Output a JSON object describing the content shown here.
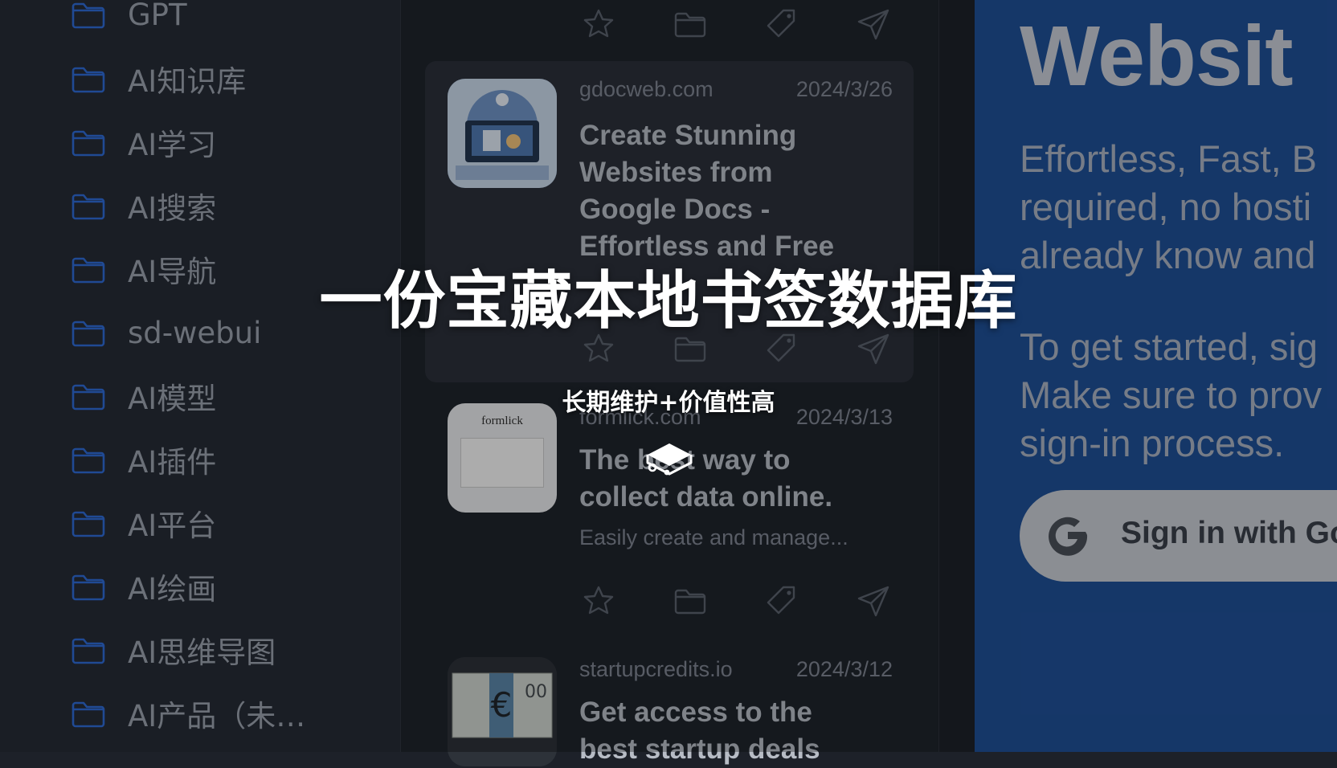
{
  "sidebar": {
    "folders": [
      {
        "label": "GPT"
      },
      {
        "label": "AI知识库"
      },
      {
        "label": "AI学习"
      },
      {
        "label": "AI搜索"
      },
      {
        "label": "AI导航"
      },
      {
        "label": "sd-webui"
      },
      {
        "label": "AI模型"
      },
      {
        "label": "AI插件"
      },
      {
        "label": "AI平台"
      },
      {
        "label": "AI绘画"
      },
      {
        "label": "AI思维导图"
      },
      {
        "label": "AI产品（未…"
      }
    ]
  },
  "bookmarks": [
    {
      "domain": "gdocweb.com",
      "date": "2024/3/26",
      "title_lines": [
        "Create Stunning",
        "Websites from",
        "Google Docs -",
        "Effortless and Free"
      ]
    },
    {
      "domain": "formlick.com",
      "date": "2024/3/13",
      "title_lines": [
        "The best way to",
        "collect data online."
      ],
      "description": "Easily create and manage...",
      "thumb_text": "formlick"
    },
    {
      "domain": "startupcredits.io",
      "date": "2024/3/12",
      "title_lines": [
        "Get access to the",
        "best startup deals"
      ]
    }
  ],
  "actions": {
    "icons": [
      "star-icon",
      "folder-icon",
      "tag-icon",
      "send-icon"
    ]
  },
  "preview": {
    "heading": "Websit",
    "paragraph1": [
      "Effortless, Fast, B",
      "required, no hosti",
      "already know and"
    ],
    "paragraph2": [
      "To get started, sig",
      "Make sure to prov",
      "sign-in process."
    ],
    "signin_label": "Sign in with Go",
    "brand_color": "#1f4f96"
  },
  "overlay": {
    "title": "一份宝藏本地书签数据库",
    "subtitle": "长期维护+价值性高"
  },
  "colors": {
    "sidebar_bg": "#262b35",
    "list_bg": "#1f242c",
    "folder_blue": "#2f6bd4",
    "selected_card": "#2b303a"
  }
}
